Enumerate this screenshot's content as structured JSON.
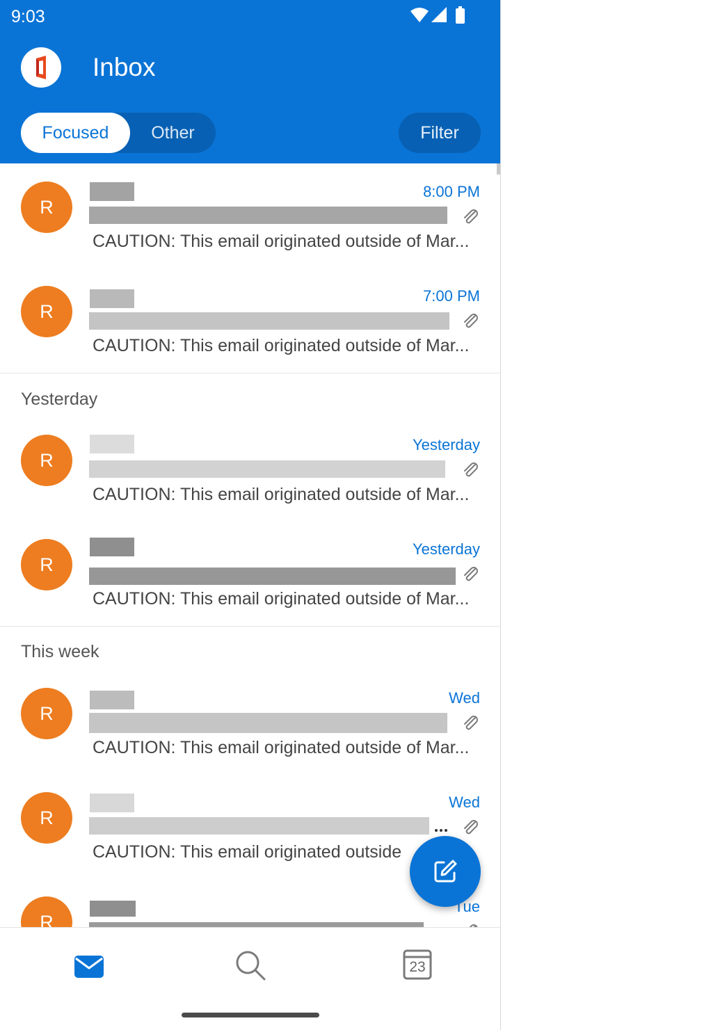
{
  "status": {
    "time": "9:03",
    "icons": [
      "wifi-icon",
      "cellular-signal-icon",
      "battery-icon"
    ]
  },
  "header": {
    "title": "Inbox",
    "account_icon": "office-logo-icon"
  },
  "tabs": {
    "focused": "Focused",
    "other": "Other",
    "selected": "Focused"
  },
  "filter_label": "Filter",
  "sections": {
    "yesterday": "Yesterday",
    "this_week": "This week"
  },
  "emails": [
    {
      "avatar": "R",
      "time": "8:00 PM",
      "preview": "CAUTION: This email originated outside of Mar...",
      "has_attachment": true
    },
    {
      "avatar": "R",
      "time": "7:00 PM",
      "preview": "CAUTION: This email originated outside of Mar...",
      "has_attachment": true
    },
    {
      "avatar": "R",
      "time": "Yesterday",
      "preview": "CAUTION: This email originated outside of Mar...",
      "has_attachment": true
    },
    {
      "avatar": "R",
      "time": "Yesterday",
      "preview": "CAUTION: This email originated outside of Mar...",
      "has_attachment": true
    },
    {
      "avatar": "R",
      "time": "Wed",
      "preview": "CAUTION: This email originated outside of Mar...",
      "has_attachment": true
    },
    {
      "avatar": "R",
      "time": "Wed",
      "preview": "CAUTION: This email originated outside",
      "has_attachment": true
    },
    {
      "avatar": "R",
      "time": "Tue",
      "preview": "",
      "has_attachment": true
    }
  ],
  "colors": {
    "brand": "#0a74d6",
    "avatar": "#ed7d20"
  },
  "fab_icon": "compose-icon",
  "bottom_nav": {
    "items": [
      "mail-icon",
      "search-icon",
      "calendar-icon"
    ],
    "calendar_day": "23",
    "selected": "mail-icon"
  }
}
